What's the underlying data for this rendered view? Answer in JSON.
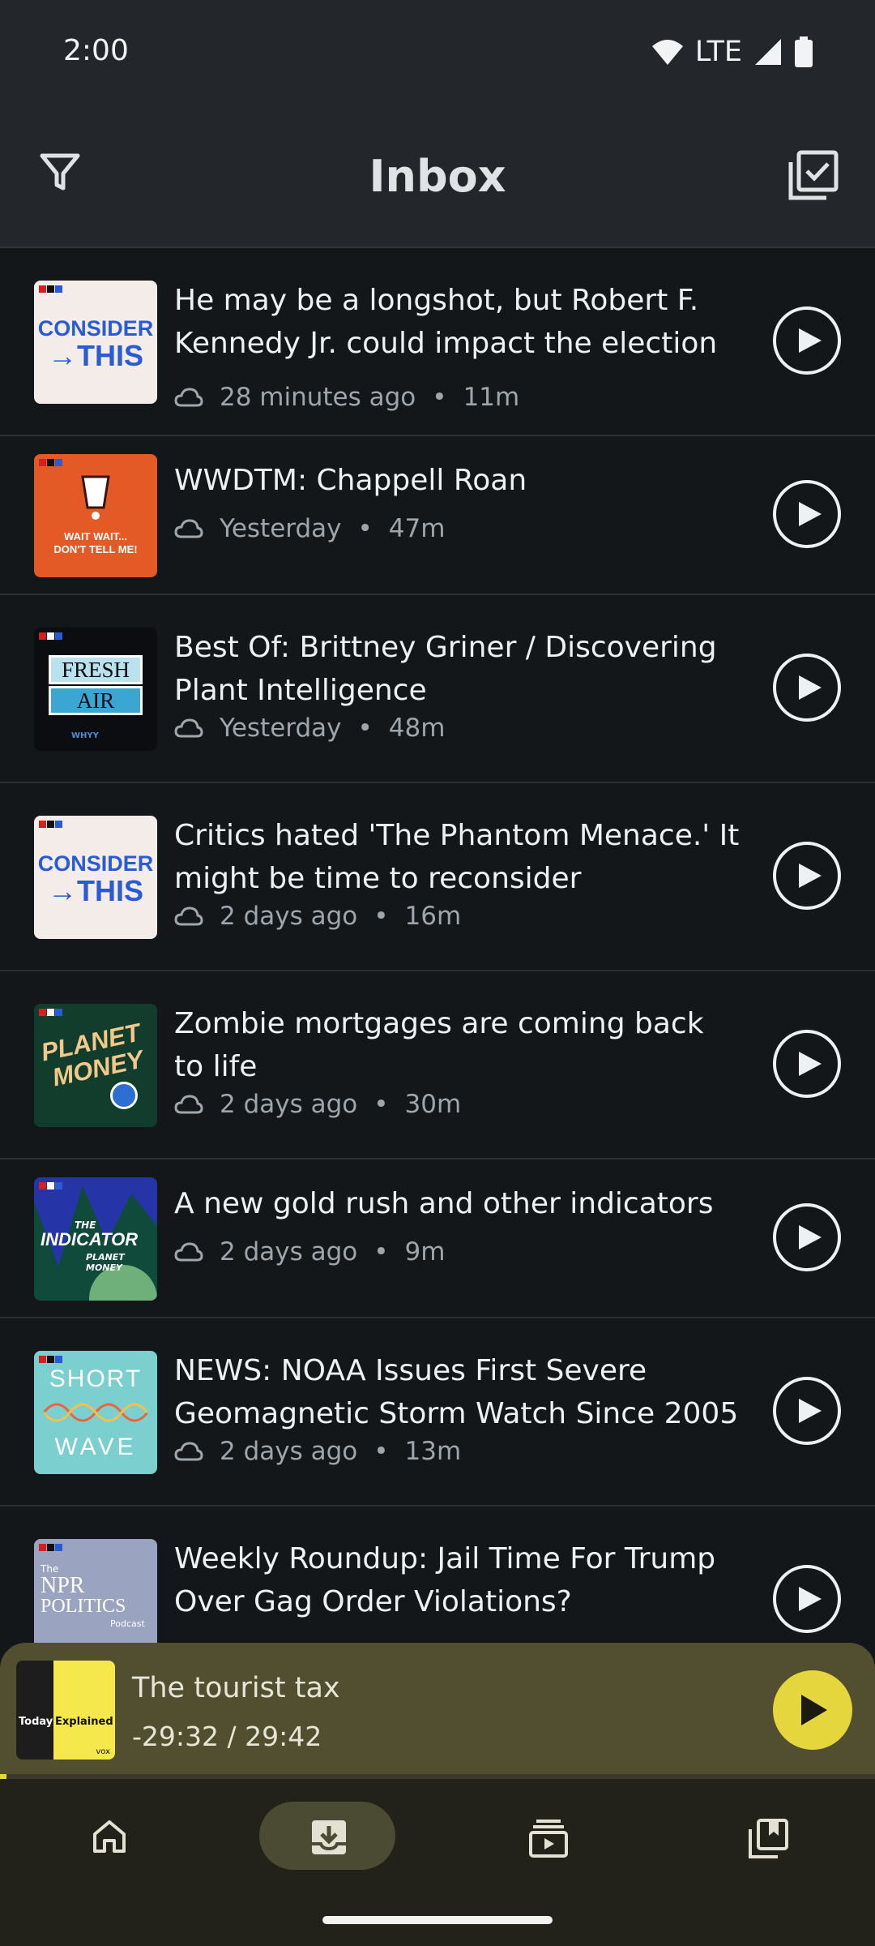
{
  "status_bar": {
    "time": "2:00",
    "network": "LTE"
  },
  "header": {
    "title": "Inbox"
  },
  "episodes": [
    {
      "title": "He may be a longshot, but Robert F. Kennedy Jr. could impact the election",
      "age": "28 minutes ago",
      "duration": "11m",
      "podcast_art": "consider-this",
      "art_lines": [
        "CONSIDER",
        "→THIS"
      ]
    },
    {
      "title": "WWDTM: Chappell Roan",
      "age": "Yesterday",
      "duration": "47m",
      "podcast_art": "wait-wait",
      "art_lines": [
        "WAIT WAIT...",
        "DON'T TELL ME!"
      ]
    },
    {
      "title": "Best Of: Brittney Griner / Discovering Plant Intelligence",
      "age": "Yesterday",
      "duration": "48m",
      "podcast_art": "fresh-air",
      "art_lines": [
        "FRESH",
        "AIR",
        "WHYY"
      ]
    },
    {
      "title": "Critics hated 'The Phantom Menace.' It might be time to reconsider",
      "age": "2 days ago",
      "duration": "16m",
      "podcast_art": "consider-this",
      "art_lines": [
        "CONSIDER",
        "→THIS"
      ]
    },
    {
      "title": "Zombie mortgages are coming back to life",
      "age": "2 days ago",
      "duration": "30m",
      "podcast_art": "planet-money",
      "art_lines": [
        "PLANET",
        "MONEY"
      ]
    },
    {
      "title": "A new gold rush and other indicators",
      "age": "2 days ago",
      "duration": "9m",
      "podcast_art": "the-indicator",
      "art_lines": [
        "THE",
        "INDICATOR",
        "PLANET MONEY"
      ]
    },
    {
      "title": "NEWS: NOAA Issues First Severe Geomagnetic Storm Watch Since 2005",
      "age": "2 days ago",
      "duration": "13m",
      "podcast_art": "short-wave",
      "art_lines": [
        "SHORT",
        "WAVE"
      ]
    },
    {
      "title": "Weekly Roundup: Jail Time For Trump Over Gag Order Violations?",
      "age": "",
      "duration": "",
      "podcast_art": "npr-politics",
      "art_lines": [
        "The",
        "NPR",
        "POLITICS",
        "Podcast"
      ]
    }
  ],
  "now_playing": {
    "title": "The tourist tax",
    "time": "-29:32 / 29:42",
    "progress": 0.007,
    "art_lines": [
      "Today",
      "Explained",
      "vox"
    ]
  },
  "nav": [
    {
      "name": "home",
      "active": false
    },
    {
      "name": "inbox",
      "active": true
    },
    {
      "name": "queue",
      "active": false
    },
    {
      "name": "library",
      "active": false
    }
  ],
  "colors": {
    "accent": "#e5d63e",
    "background": "#13171a",
    "player_bg": "#514f30"
  }
}
